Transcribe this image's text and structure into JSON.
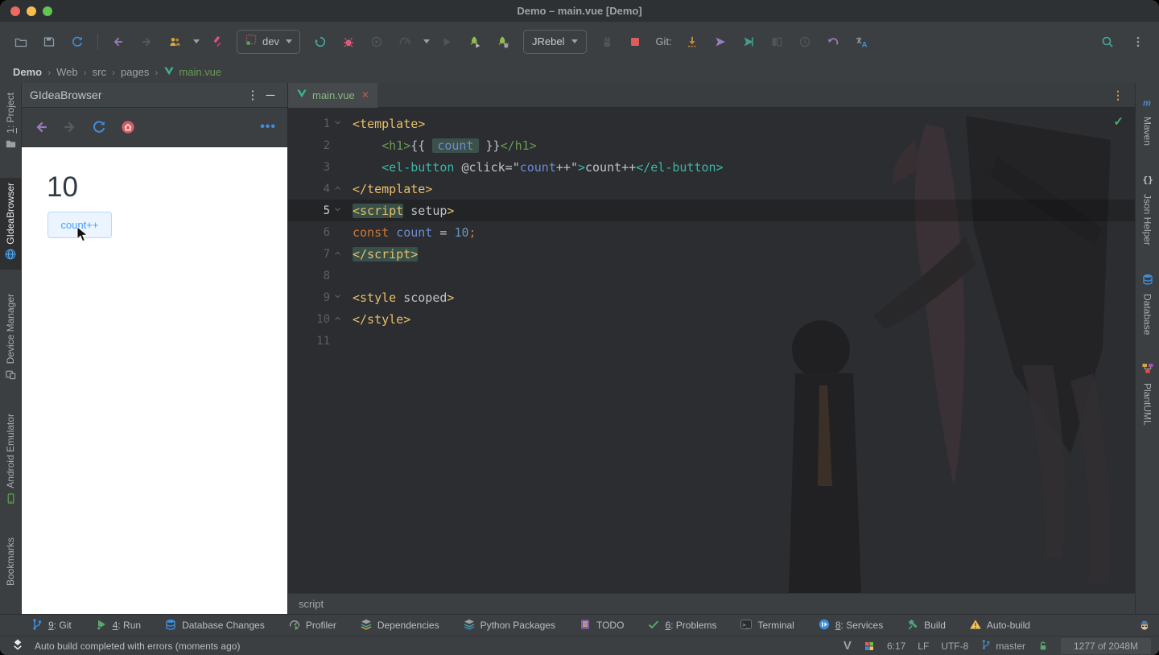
{
  "window": {
    "title": "Demo – main.vue [Demo]"
  },
  "toolbar": {
    "run_config_label": "dev",
    "jrebel_label": "JRebel",
    "git_label": "Git:",
    "left_items": [
      {
        "icon": "folder",
        "name": "open-folder-icon",
        "interact": true
      },
      {
        "icon": "save",
        "name": "save-all-icon",
        "interact": true
      },
      {
        "icon": "sync",
        "name": "sync-icon",
        "interact": true
      },
      {
        "sep": true
      },
      {
        "icon": "back",
        "name": "navigate-back-icon",
        "interact": true
      },
      {
        "icon": "forward",
        "name": "navigate-forward-icon",
        "interact": true,
        "dim": true
      },
      {
        "icon": "users",
        "name": "code-with-me-icon",
        "interact": true,
        "dropdown": true
      },
      {
        "icon": "driver",
        "name": "screwdriver-icon",
        "interact": true
      },
      {
        "runconfig": true
      },
      {
        "icon": "rerun",
        "name": "rerun-icon",
        "interact": true
      },
      {
        "icon": "bug",
        "name": "debug-icon",
        "interact": true
      },
      {
        "icon": "coverage",
        "name": "run-with-coverage-icon",
        "interact": true,
        "dim": true
      },
      {
        "icon": "gauge",
        "name": "profiler-icon",
        "interact": true,
        "dim": true,
        "dropdown": true
      },
      {
        "icon": "playdim",
        "name": "run-disabled-icon",
        "interact": true,
        "dim": true
      },
      {
        "icon": "rocketrun",
        "name": "jrebel-run-icon",
        "interact": true
      },
      {
        "icon": "rocketdebug",
        "name": "jrebel-debug-icon",
        "interact": true
      },
      {
        "jrebel": true
      },
      {
        "icon": "rabbit",
        "name": "jrebel-agent-icon",
        "interact": true,
        "dim": true
      },
      {
        "icon": "stop",
        "name": "stop-icon",
        "interact": true
      },
      {
        "gitlabel": true
      },
      {
        "icon": "update",
        "name": "git-update-icon",
        "interact": true
      },
      {
        "icon": "push",
        "name": "git-push-icon",
        "interact": true
      },
      {
        "icon": "commit",
        "name": "git-commit-icon",
        "interact": true
      },
      {
        "icon": "diff",
        "name": "git-diff-icon",
        "interact": true,
        "dim": true
      },
      {
        "icon": "history",
        "name": "git-history-icon",
        "interact": true,
        "dim": true
      },
      {
        "icon": "undo",
        "name": "git-rollback-icon",
        "interact": true
      },
      {
        "icon": "translate",
        "name": "translate-icon",
        "interact": true
      }
    ],
    "right_items": [
      {
        "icon": "search",
        "name": "search-everywhere-icon",
        "interact": true
      },
      {
        "icon": "kebab",
        "name": "main-menu-kebab-icon",
        "interact": true
      }
    ]
  },
  "navbar": {
    "separator": "›",
    "crumbs": [
      {
        "label": "Demo",
        "bold": true
      },
      {
        "label": "Web"
      },
      {
        "label": "src"
      },
      {
        "label": "pages"
      },
      {
        "label": "main.vue",
        "vue": true
      }
    ]
  },
  "left_stripe": [
    {
      "num": "1",
      "label": ": Project",
      "icon": "projfolder"
    },
    {
      "label": "GIdeaBrowser",
      "icon": "globe",
      "active": true
    },
    {
      "label": "Device Manager",
      "icon": "device"
    },
    {
      "label": "Android Emulator",
      "icon": "android"
    },
    {
      "label": "Bookmarks"
    }
  ],
  "right_stripe": [
    {
      "label": "Maven",
      "icon": "maven"
    },
    {
      "label": "Json Helper",
      "icon": "json"
    },
    {
      "label": "Database",
      "icon": "dbsmall"
    },
    {
      "label": "PlantUML",
      "icon": "plantuml"
    }
  ],
  "browser_panel": {
    "title": "GIdeaBrowser",
    "kebab": "⋮",
    "minimize": "─",
    "more": "•••",
    "toolbar": [
      {
        "icon": "bback",
        "name": "browser-back-icon"
      },
      {
        "icon": "bforward",
        "name": "browser-forward-icon"
      },
      {
        "icon": "brefresh",
        "name": "browser-refresh-icon"
      },
      {
        "icon": "home",
        "name": "browser-home-icon"
      }
    ],
    "content": {
      "heading": "10",
      "button_label": "count++"
    }
  },
  "editor": {
    "tab_label": "main.vue",
    "tab_close": "✕",
    "inspection_check": "✓",
    "tab_kebab": "⋮",
    "breadcrumb": "script",
    "active_line": 5,
    "lines": [
      {
        "n": 1,
        "fold": "open",
        "tokens": [
          {
            "s": "<template>",
            "c": "to"
          }
        ]
      },
      {
        "n": 2,
        "tokens": [
          {
            "s": "    ",
            "c": "pl"
          },
          {
            "s": "<h1>",
            "c": "tg"
          },
          {
            "s": "{{ ",
            "c": "pl"
          },
          {
            "s": "count",
            "c": "vr hl"
          },
          {
            "s": " }}",
            "c": "pl"
          },
          {
            "s": "</h1>",
            "c": "tg"
          }
        ]
      },
      {
        "n": 3,
        "tokens": [
          {
            "s": "    ",
            "c": "pl"
          },
          {
            "s": "<el-button",
            "c": "tt"
          },
          {
            "s": " @click=",
            "c": "pl"
          },
          {
            "s": "\"",
            "c": "pl"
          },
          {
            "s": "count",
            "c": "vr"
          },
          {
            "s": "++",
            "c": "pl"
          },
          {
            "s": "\"",
            "c": "pl"
          },
          {
            "s": ">",
            "c": "tt"
          },
          {
            "s": "count++",
            "c": "pl"
          },
          {
            "s": "</el-button>",
            "c": "tt"
          }
        ]
      },
      {
        "n": 4,
        "fold": "close",
        "tokens": [
          {
            "s": "</template>",
            "c": "to"
          }
        ]
      },
      {
        "n": 5,
        "fold": "open",
        "tokens": [
          {
            "s": "<script",
            "c": "to mh"
          },
          {
            "s": " setup",
            "c": "pl"
          },
          {
            "s": ">",
            "c": "to"
          }
        ]
      },
      {
        "n": 6,
        "tokens": [
          {
            "s": "const",
            "c": "kw"
          },
          {
            "s": " ",
            "c": "pl"
          },
          {
            "s": "count",
            "c": "vr"
          },
          {
            "s": " = ",
            "c": "pl"
          },
          {
            "s": "10",
            "c": "nm"
          },
          {
            "s": ";",
            "c": "kw"
          }
        ]
      },
      {
        "n": 7,
        "fold": "close",
        "tokens": [
          {
            "s": "</script>",
            "c": "to mh"
          }
        ]
      },
      {
        "n": 8,
        "tokens": []
      },
      {
        "n": 9,
        "fold": "open",
        "tokens": [
          {
            "s": "<style",
            "c": "to"
          },
          {
            "s": " scoped",
            "c": "pl"
          },
          {
            "s": ">",
            "c": "to"
          }
        ]
      },
      {
        "n": 10,
        "fold": "close",
        "tokens": [
          {
            "s": "</style>",
            "c": "to"
          }
        ]
      },
      {
        "n": 11,
        "tokens": []
      }
    ]
  },
  "bottom_bar": [
    {
      "num": "9",
      "label": "Git",
      "icon": "branch"
    },
    {
      "num": "4",
      "label": "Run",
      "icon": "rungreen"
    },
    {
      "label": "Database Changes",
      "icon": "dbsmall"
    },
    {
      "label": "Profiler",
      "icon": "profb"
    },
    {
      "label": "Dependencies",
      "icon": "layers1"
    },
    {
      "label": "Python Packages",
      "icon": "layers2"
    },
    {
      "label": "TODO",
      "icon": "todo"
    },
    {
      "num": "6",
      "label": "Problems",
      "icon": "checkg"
    },
    {
      "label": "Terminal",
      "icon": "terminal"
    },
    {
      "num": "8",
      "label": "Services",
      "icon": "services"
    },
    {
      "label": "Build",
      "icon": "hammer"
    },
    {
      "label": "Auto-build",
      "icon": "warn"
    }
  ],
  "status_bar": {
    "message": "Auto build completed with errors (moments ago)",
    "line_col": "6:17",
    "line_ending": "LF",
    "encoding": "UTF-8",
    "branch": "master",
    "memory": "1277 of 2048M"
  }
}
